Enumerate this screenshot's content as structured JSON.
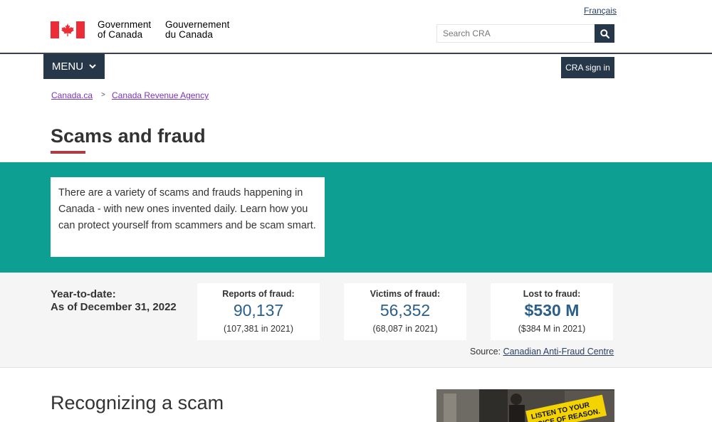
{
  "header": {
    "language_toggle": "Français",
    "gov_en_line1": "Government",
    "gov_en_line2": "of Canada",
    "gov_fr_line1": "Gouvernement",
    "gov_fr_line2": "du Canada",
    "search_placeholder": "Search CRA",
    "search_icon": "search-icon"
  },
  "nav": {
    "menu_label": "MENU",
    "menu_icon": "chevron-down-icon",
    "sign_in_label": "CRA sign in"
  },
  "breadcrumb": {
    "items": [
      "Canada.ca",
      "Canada Revenue Agency"
    ],
    "separator": ">"
  },
  "page": {
    "title": "Scams and fraud",
    "intro": "There are a variety of scams and frauds happening in Canada - with new ones invented daily. Learn how you can protect yourself from scammers and be scam smart."
  },
  "stats": {
    "period_label": "Year-to-date:",
    "period_date": "As of December 31, 2022",
    "cards": [
      {
        "label": "Reports of fraud:",
        "value": "90,137",
        "previous": "(107,381 in 2021)"
      },
      {
        "label": "Victims of fraud:",
        "value": "56,352",
        "previous": "(68,087 in 2021)"
      },
      {
        "label": "Lost to fraud:",
        "value": "$530 M",
        "previous": "($384 M in 2021)"
      }
    ],
    "source_prefix": "Source:",
    "source_link": "Canadian Anti-Fraud Centre"
  },
  "section": {
    "title": "Recognizing a scam"
  },
  "promo": {
    "sign_text_line1": "LISTEN TO YOUR",
    "sign_text_line2": "VOICE OF REASON."
  },
  "colors": {
    "gov_red": "#eb2d37",
    "navy": "#26374a",
    "teal": "#0e9f93",
    "title_accent": "#af3c43",
    "stat_blue": "#2b5f8a",
    "visited_link": "#7834bc"
  }
}
